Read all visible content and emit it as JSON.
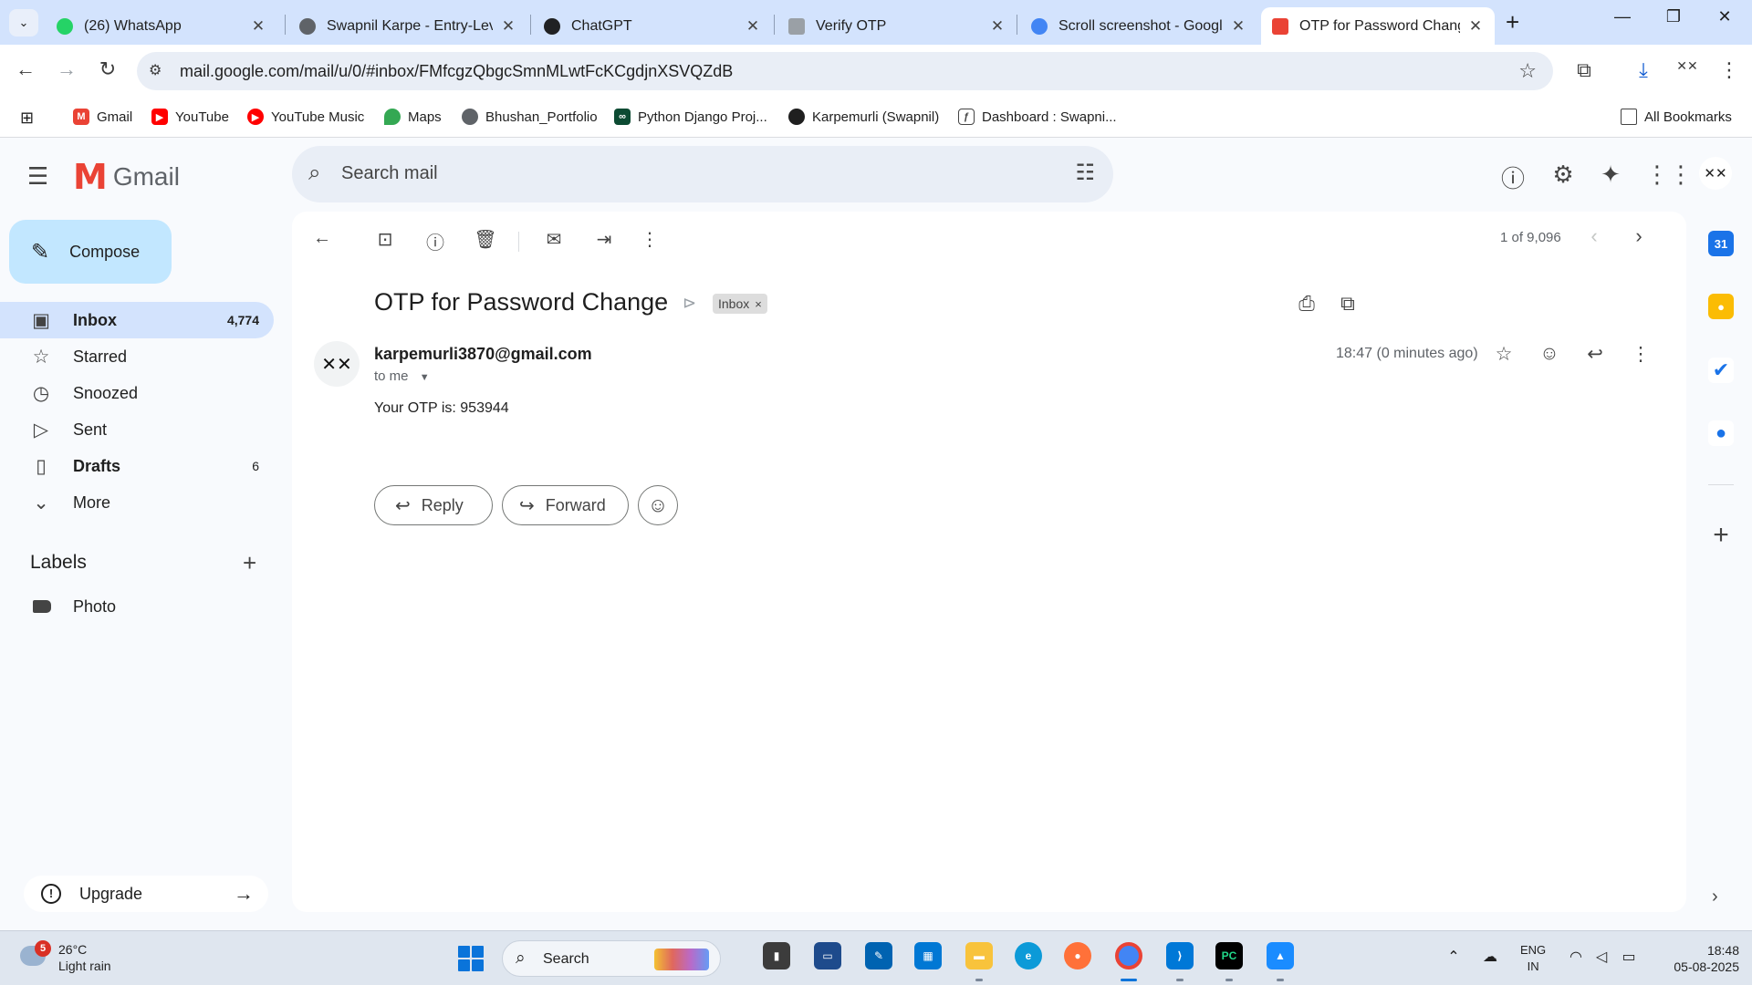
{
  "browser": {
    "tabs": [
      {
        "title": "(26) WhatsApp",
        "favicon": "whatsapp-icon",
        "color": "#25d366",
        "badge": "26"
      },
      {
        "title": "Swapnil Karpe - Entry-Leve",
        "favicon": "globe-icon",
        "color": "#5f6368"
      },
      {
        "title": "ChatGPT",
        "favicon": "chatgpt-icon",
        "color": "#202123"
      },
      {
        "title": "Verify OTP",
        "favicon": "page-icon",
        "color": "#9aa0a6"
      },
      {
        "title": "Scroll screenshot - Google",
        "favicon": "google-icon",
        "color": "#4285f4"
      },
      {
        "title": "OTP for Password Change",
        "favicon": "gmail-icon",
        "color": "#ea4335",
        "active": true
      }
    ],
    "close_glyph": "✕",
    "new_tab_glyph": "+",
    "url": "mail.google.com/mail/u/0/#inbox/FMfcgzQbgcSmnMLwtFcKCgdjnXSVQZdB",
    "bookmarks": [
      {
        "label": "Gmail",
        "icon": "gmail-icon"
      },
      {
        "label": "YouTube",
        "icon": "youtube-icon"
      },
      {
        "label": "YouTube Music",
        "icon": "youtube-music-icon"
      },
      {
        "label": "Maps",
        "icon": "maps-icon"
      },
      {
        "label": "Bhushan_Portfolio",
        "icon": "globe-icon"
      },
      {
        "label": "Python Django Proj...",
        "icon": "link-icon"
      },
      {
        "label": "Karpemurli (Swapnil)",
        "icon": "github-icon"
      },
      {
        "label": "Dashboard : Swapni...",
        "icon": "dashboard-icon"
      }
    ],
    "all_bookmarks": "All Bookmarks"
  },
  "gmail": {
    "brand": "Gmail",
    "search_placeholder": "Search mail",
    "compose_label": "Compose",
    "nav": [
      {
        "label": "Inbox",
        "count": "4,774",
        "icon": "inbox-icon",
        "active": true,
        "bold": true
      },
      {
        "label": "Starred",
        "count": "",
        "icon": "star-icon"
      },
      {
        "label": "Snoozed",
        "count": "",
        "icon": "clock-icon"
      },
      {
        "label": "Sent",
        "count": "",
        "icon": "send-icon"
      },
      {
        "label": "Drafts",
        "count": "6",
        "icon": "draft-icon",
        "bold": true
      },
      {
        "label": "More",
        "count": "",
        "icon": "chevron-down-icon"
      }
    ],
    "labels_heading": "Labels",
    "labels": [
      {
        "label": "Photo",
        "icon": "label-icon"
      }
    ],
    "upgrade_label": "Upgrade",
    "pager": "1 of 9,096",
    "message": {
      "subject": "OTP for Password Change",
      "label_chip": "Inbox",
      "sender": "karpemurli3870@gmail.com",
      "recipient": "to me",
      "time": "18:47 (0 minutes ago)",
      "body": "Your OTP is: 953944",
      "reply_label": "Reply",
      "forward_label": "Forward"
    }
  },
  "taskbar": {
    "weather_temp": "26°C",
    "weather_cond": "Light rain",
    "weather_badge": "5",
    "search_label": "Search",
    "lang_line1": "ENG",
    "lang_line2": "IN",
    "time": "18:48",
    "date": "05-08-2025"
  },
  "colors": {
    "accent": "#0b57d0",
    "compose_bg": "#c2e7ff",
    "active_nav": "#d3e3fd",
    "tabbar": "#d3e3fd"
  }
}
